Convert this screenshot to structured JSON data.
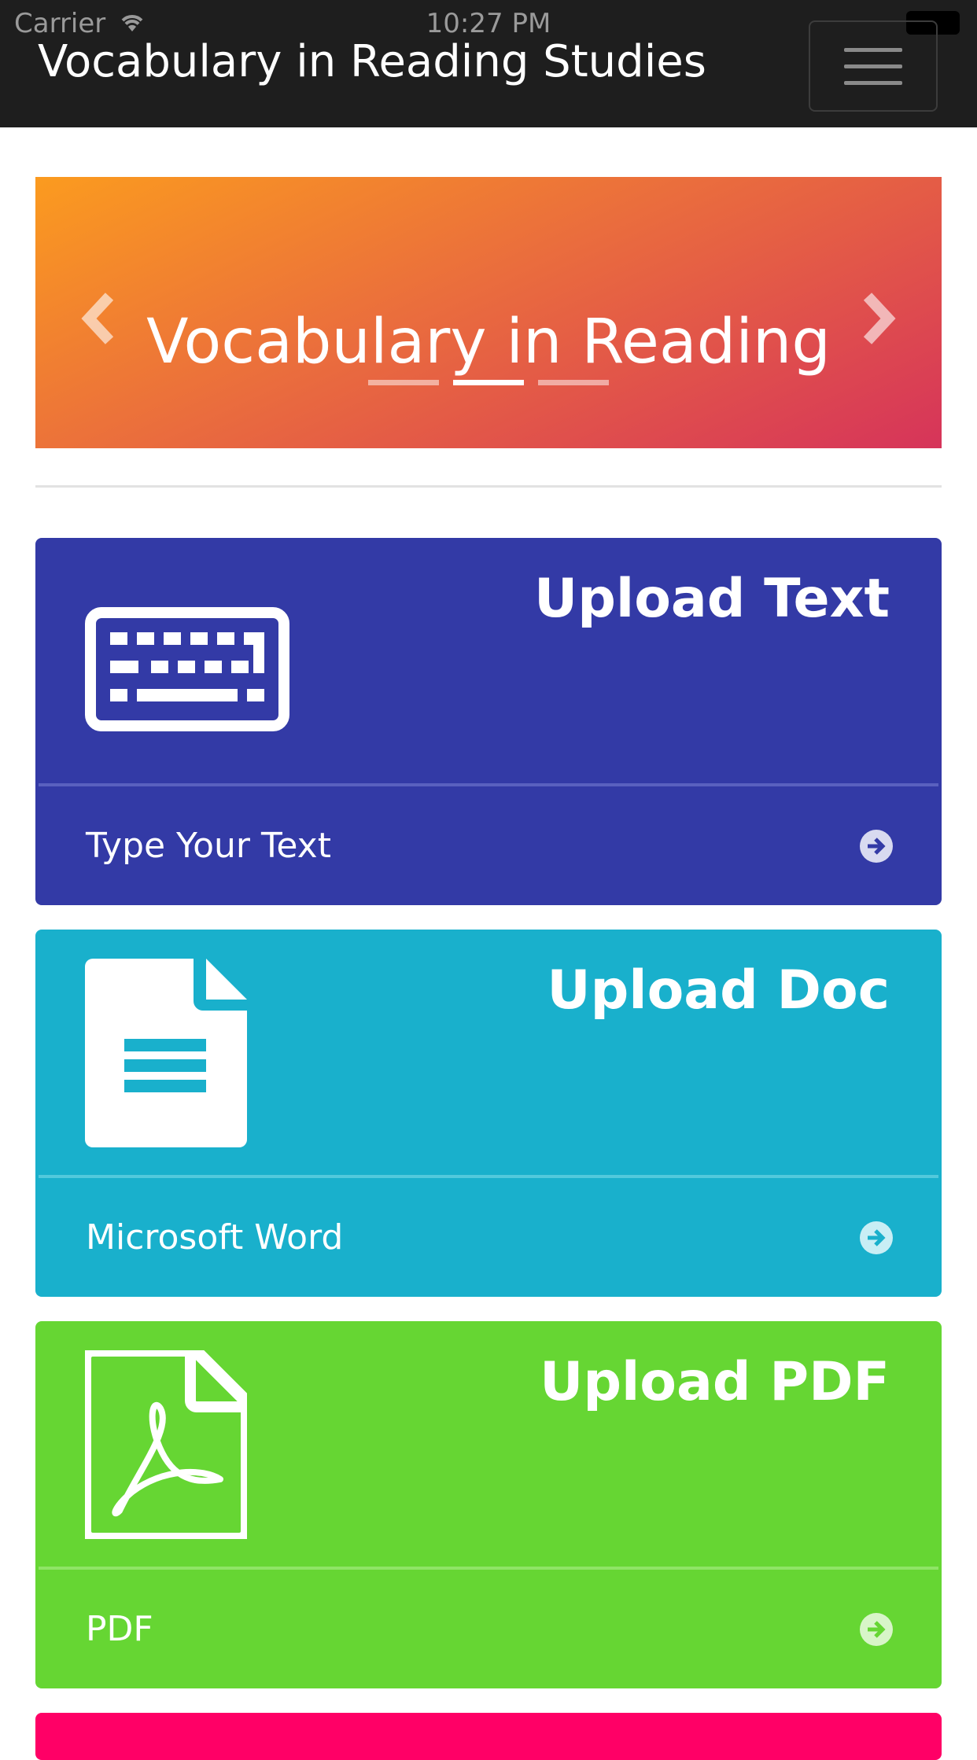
{
  "status_bar": {
    "carrier": "Carrier",
    "time": "10:27 PM"
  },
  "navbar": {
    "brand": "Vocabulary in Reading Studies",
    "menu_icon": "hamburger-icon"
  },
  "carousel": {
    "title": "Vocabulary in Reading",
    "prev_icon": "chevron-left-icon",
    "next_icon": "chevron-right-icon",
    "indicator_count": 3,
    "active_indicator": 1
  },
  "cards": [
    {
      "title": "Upload Text",
      "footer": "Type Your Text",
      "icon": "keyboard-icon",
      "color": "#333aa6"
    },
    {
      "title": "Upload Doc",
      "footer": "Microsoft Word",
      "icon": "document-icon",
      "color": "#19b0cc"
    },
    {
      "title": "Upload PDF",
      "footer": "PDF",
      "icon": "pdf-icon",
      "color": "#66d633"
    }
  ],
  "colors": {
    "navbar_bg": "#1e1e1e",
    "next_card": "#ff0066"
  }
}
